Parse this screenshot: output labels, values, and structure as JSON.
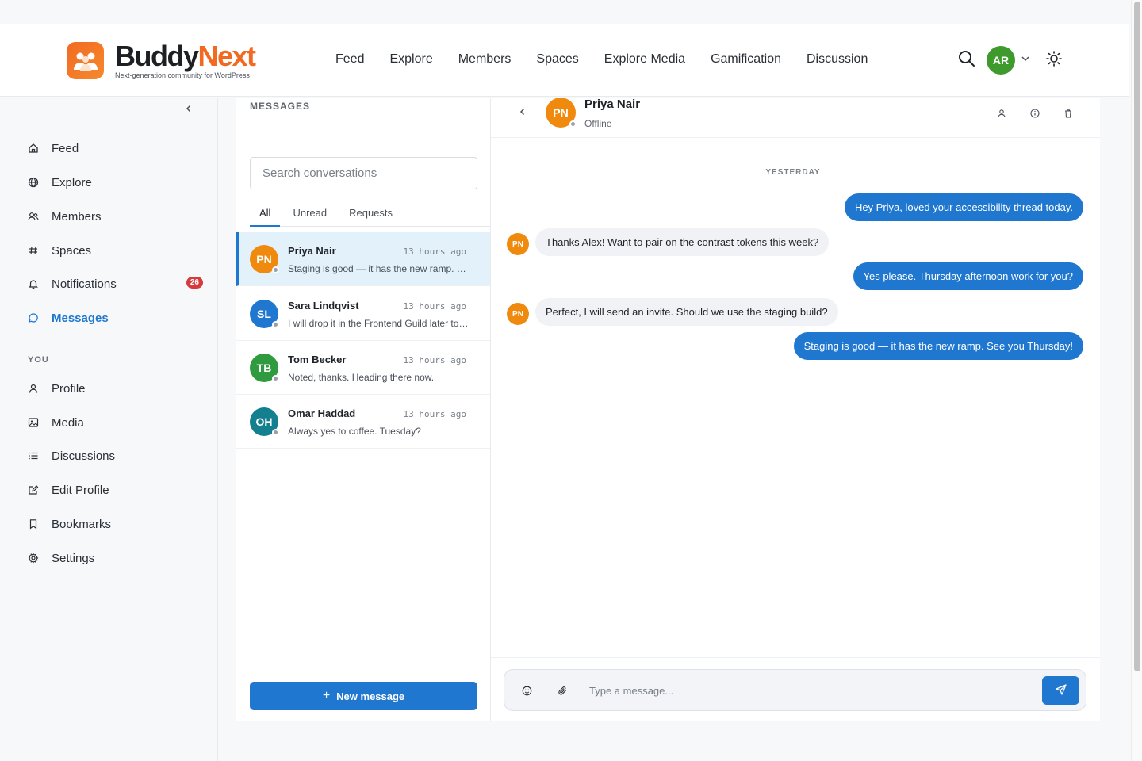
{
  "brand": {
    "name_part1": "Buddy",
    "name_part2": "Next",
    "tagline": "Next-generation community for WordPress",
    "accent": "#f26a22"
  },
  "nav": [
    "Feed",
    "Explore",
    "Members",
    "Spaces",
    "Explore Media",
    "Gamification",
    "Discussion"
  ],
  "user": {
    "initials": "AR",
    "color": "#3e9a2c"
  },
  "sidebar": {
    "items": [
      {
        "label": "Feed",
        "icon": "home-icon"
      },
      {
        "label": "Explore",
        "icon": "globe-icon"
      },
      {
        "label": "Members",
        "icon": "users-icon"
      },
      {
        "label": "Spaces",
        "icon": "hash-icon"
      },
      {
        "label": "Notifications",
        "icon": "bell-icon",
        "badge": "26"
      },
      {
        "label": "Messages",
        "icon": "chat-icon",
        "active": true
      }
    ],
    "section_you": "YOU",
    "you_items": [
      {
        "label": "Profile",
        "icon": "user-icon"
      },
      {
        "label": "Media",
        "icon": "image-icon"
      },
      {
        "label": "Discussions",
        "icon": "list-icon"
      },
      {
        "label": "Edit Profile",
        "icon": "edit-icon"
      },
      {
        "label": "Bookmarks",
        "icon": "bookmark-icon"
      },
      {
        "label": "Settings",
        "icon": "gear-icon"
      }
    ]
  },
  "messages": {
    "title": "MESSAGES",
    "search_placeholder": "Search conversations",
    "tabs": [
      "All",
      "Unread",
      "Requests"
    ],
    "conversations": [
      {
        "initials": "PN",
        "name": "Priya Nair",
        "time": "13 hours ago",
        "snippet": "Staging is good — it has the new ramp. See you Thursday!",
        "color": "#ef8a0f"
      },
      {
        "initials": "SL",
        "name": "Sara Lindqvist",
        "time": "13 hours ago",
        "snippet": "I will drop it in the Frontend Guild later today.",
        "color": "#1f77d0"
      },
      {
        "initials": "TB",
        "name": "Tom Becker",
        "time": "13 hours ago",
        "snippet": "Noted, thanks. Heading there now.",
        "color": "#2f9a3e"
      },
      {
        "initials": "OH",
        "name": "Omar Haddad",
        "time": "13 hours ago",
        "snippet": "Always yes to coffee. Tuesday?",
        "color": "#147f8f"
      }
    ],
    "new_message_label": "New message"
  },
  "chat": {
    "contact": {
      "initials": "PN",
      "name": "Priya Nair",
      "status": "Offline"
    },
    "day_label": "YESTERDAY",
    "thread": [
      {
        "dir": "out",
        "text": "Hey Priya, loved your accessibility thread today."
      },
      {
        "dir": "in",
        "text": "Thanks Alex! Want to pair on the contrast tokens this week?"
      },
      {
        "dir": "out",
        "text": "Yes please. Thursday afternoon work for you?"
      },
      {
        "dir": "in",
        "text": "Perfect, I will send an invite. Should we use the staging build?"
      },
      {
        "dir": "out",
        "text": "Staging is good — it has the new ramp. See you Thursday!"
      }
    ],
    "composer_placeholder": "Type a message..."
  }
}
